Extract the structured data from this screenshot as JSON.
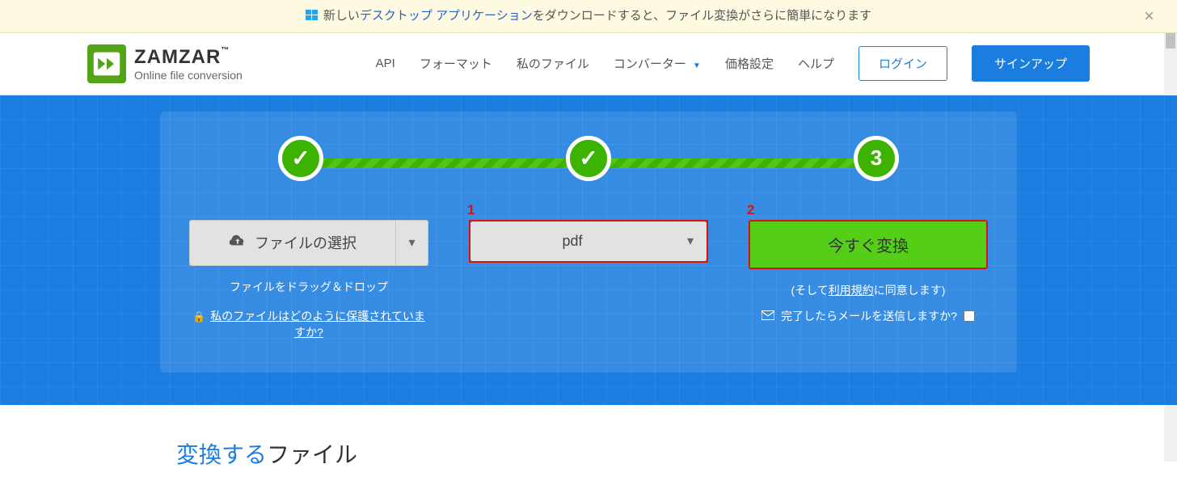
{
  "banner": {
    "prefix": "新しい",
    "desktop_app": "デスクトップ アプリケーション",
    "suffix": "をダウンロードすると、ファイル変換がさらに簡単になります"
  },
  "logo": {
    "brand": "ZAMZAR",
    "tm": "™",
    "sub": "Online file conversion"
  },
  "nav": {
    "api": "API",
    "format": "フォーマット",
    "myfiles": "私のファイル",
    "converter": "コンバーター",
    "pricing": "価格設定",
    "help": "ヘルプ",
    "login": "ログイン",
    "signup": "サインアップ"
  },
  "steps": {
    "step3": "3"
  },
  "column1": {
    "select_label": "ファイルの選択",
    "dragdrop": "ファイルをドラッグ＆ドロップ",
    "protected": "私のファイルはどのように保護されていますか?"
  },
  "column2": {
    "annotation": "1",
    "format": "pdf"
  },
  "column3": {
    "annotation": "2",
    "convert": "今すぐ変換",
    "agree_pre": "(そして",
    "agree_terms": "利用規約",
    "agree_post": "に同意します)",
    "email_label": "完了したらメールを送信しますか?"
  },
  "footer": {
    "blue": "変換する",
    "rest": "ファイル"
  }
}
